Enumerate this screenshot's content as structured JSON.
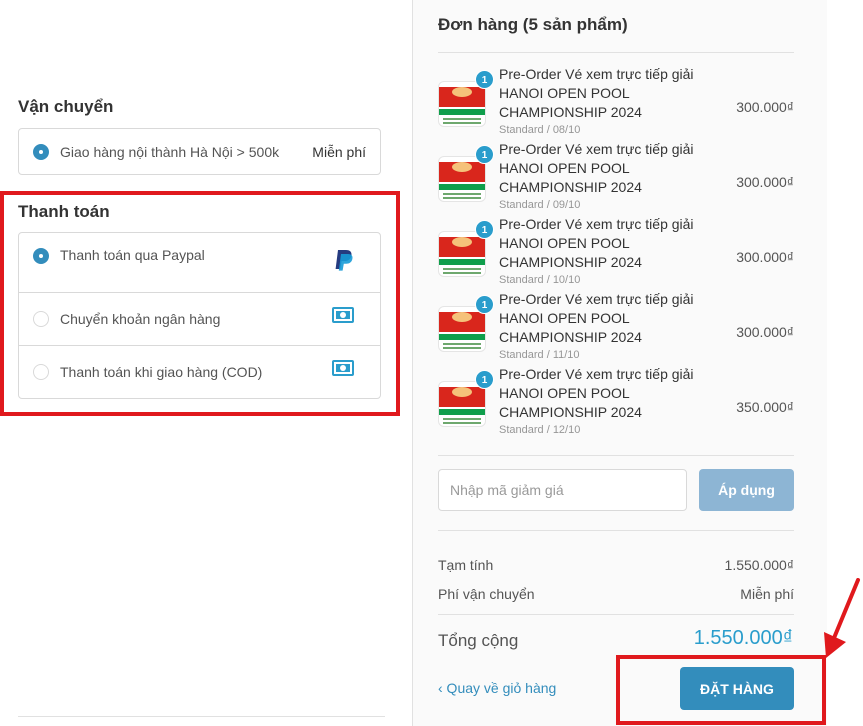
{
  "shipping": {
    "title": "Vận chuyển",
    "option": {
      "label": "Giao hàng nội thành Hà Nội > 500k",
      "price": "Miễn phí",
      "selected": true
    }
  },
  "payment": {
    "title": "Thanh toán",
    "options": [
      {
        "label": "Thanh toán qua Paypal",
        "icon": "paypal-icon",
        "selected": true
      },
      {
        "label": "Chuyển khoản ngân hàng",
        "icon": "cash-icon",
        "selected": false
      },
      {
        "label": "Thanh toán khi giao hàng (COD)",
        "icon": "cash-icon",
        "selected": false
      }
    ]
  },
  "order": {
    "title": "Đơn hàng (5 sản phẩm)",
    "items": [
      {
        "qty": "1",
        "name": "Pre-Order Vé xem trực tiếp giải HANOI OPEN POOL CHAMPIONSHIP 2024",
        "variant": "Standard / 08/10",
        "price": "300.000₫"
      },
      {
        "qty": "1",
        "name": "Pre-Order Vé xem trực tiếp giải HANOI OPEN POOL CHAMPIONSHIP 2024",
        "variant": "Standard / 09/10",
        "price": "300.000₫"
      },
      {
        "qty": "1",
        "name": "Pre-Order Vé xem trực tiếp giải HANOI OPEN POOL CHAMPIONSHIP 2024",
        "variant": "Standard / 10/10",
        "price": "300.000₫"
      },
      {
        "qty": "1",
        "name": "Pre-Order Vé xem trực tiếp giải HANOI OPEN POOL CHAMPIONSHIP 2024",
        "variant": "Standard / 11/10",
        "price": "300.000₫"
      },
      {
        "qty": "1",
        "name": "Pre-Order Vé xem trực tiếp giải HANOI OPEN POOL CHAMPIONSHIP 2024",
        "variant": "Standard / 12/10",
        "price": "350.000₫"
      }
    ],
    "discount": {
      "placeholder": "Nhập mã giảm giá",
      "value": "",
      "button": "Áp dụng"
    },
    "subtotal_label": "Tạm tính",
    "subtotal_value": "1.550.000₫",
    "shipping_label": "Phí vận chuyển",
    "shipping_value": "Miễn phí",
    "total_label": "Tổng cộng",
    "total_value": "1.550.000₫",
    "back_link": "‹ Quay về giỏ hàng",
    "submit": "ĐẶT HÀNG"
  },
  "colors": {
    "accent": "#338dbc",
    "highlight": "#e0191d",
    "badge": "#2a9dcc"
  }
}
